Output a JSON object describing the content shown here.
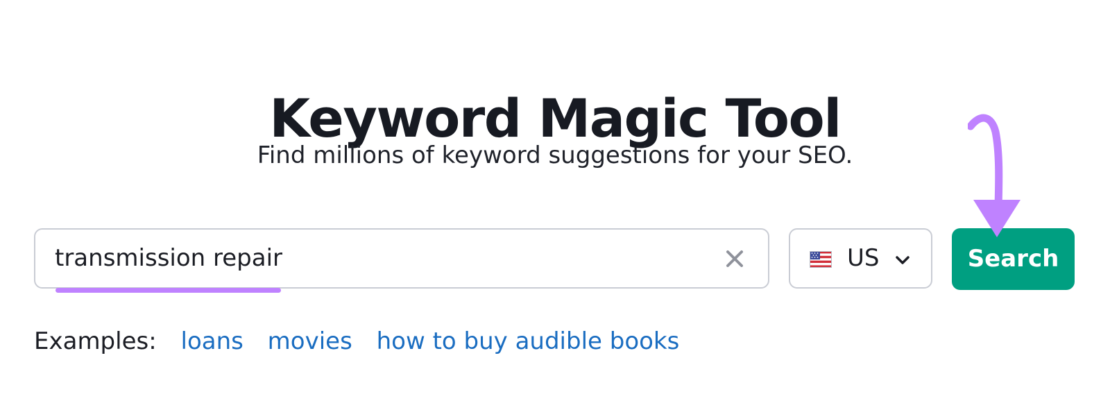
{
  "header": {
    "title": "Keyword Magic Tool",
    "subtitle": "Find millions of keyword suggestions for your SEO."
  },
  "search": {
    "value": "transmission repair",
    "clear_icon": "close-icon"
  },
  "database": {
    "flag_icon": "us-flag-icon",
    "value": "US",
    "dropdown_icon": "chevron-down-icon"
  },
  "search_button": {
    "label": "Search",
    "color": "#009f81"
  },
  "examples": {
    "label": "Examples:",
    "links": [
      "loans",
      "movies",
      "how to buy audible books"
    ]
  },
  "annotation": {
    "arrow_icon": "curved-arrow-icon",
    "color": "#bf82ff"
  }
}
